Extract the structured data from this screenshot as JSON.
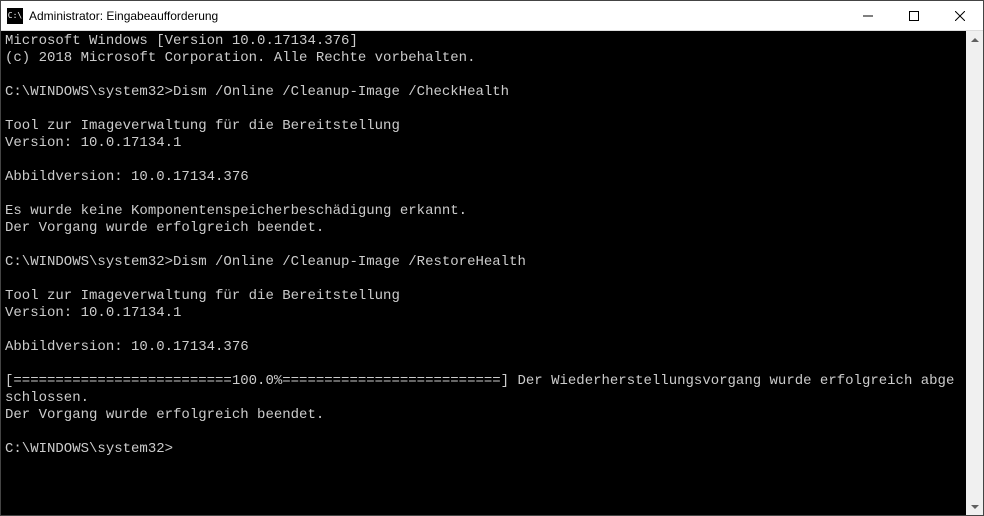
{
  "titlebar": {
    "icon_label": "C:\\",
    "title": "Administrator: Eingabeaufforderung"
  },
  "terminal": {
    "lines": [
      "Microsoft Windows [Version 10.0.17134.376]",
      "(c) 2018 Microsoft Corporation. Alle Rechte vorbehalten.",
      "",
      "C:\\WINDOWS\\system32>Dism /Online /Cleanup-Image /CheckHealth",
      "",
      "Tool zur Imageverwaltung für die Bereitstellung",
      "Version: 10.0.17134.1",
      "",
      "Abbildversion: 10.0.17134.376",
      "",
      "Es wurde keine Komponentenspeicherbeschädigung erkannt.",
      "Der Vorgang wurde erfolgreich beendet.",
      "",
      "C:\\WINDOWS\\system32>Dism /Online /Cleanup-Image /RestoreHealth",
      "",
      "Tool zur Imageverwaltung für die Bereitstellung",
      "Version: 10.0.17134.1",
      "",
      "Abbildversion: 10.0.17134.376",
      "",
      "[==========================100.0%==========================] Der Wiederherstellungsvorgang wurde erfolgreich abgeschlossen.",
      "Der Vorgang wurde erfolgreich beendet.",
      "",
      "C:\\WINDOWS\\system32>"
    ]
  }
}
